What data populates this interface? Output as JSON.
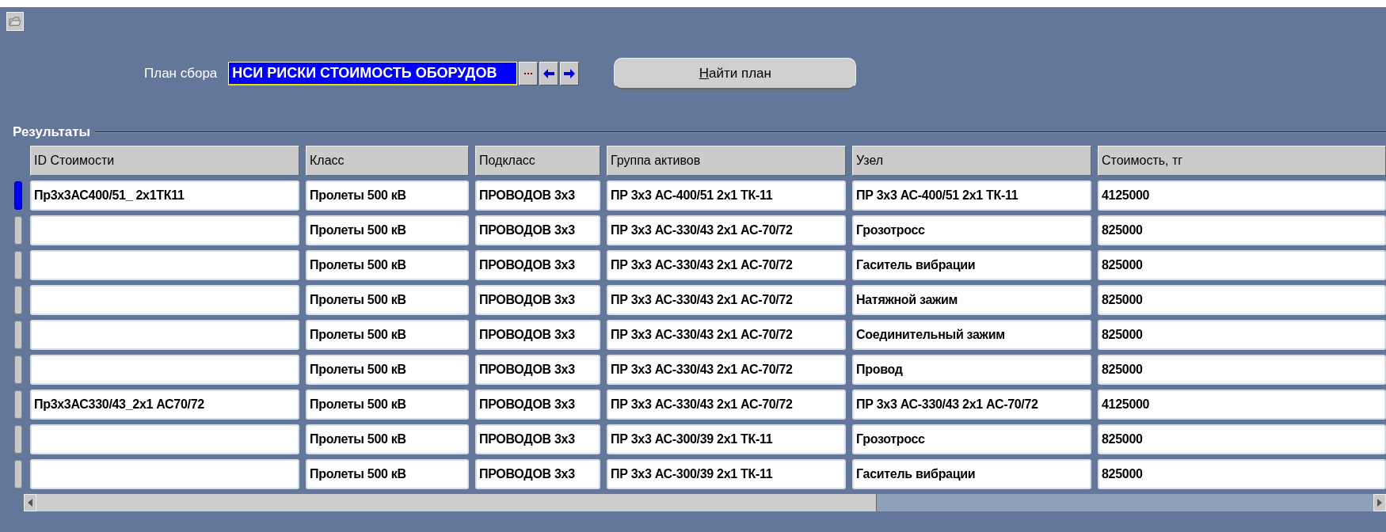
{
  "plan": {
    "label": "План сбора",
    "value": "НСИ РИСКИ СТОИМОСТЬ ОБОРУДОВ",
    "selected": true
  },
  "find_button": {
    "access_key": "Н",
    "label_rest": "айти план"
  },
  "results": {
    "title": "Результаты",
    "columns": [
      "ID Стоимости",
      "Класс",
      "Подкласс",
      "Группа активов",
      "Узел",
      "Стоимость, тг"
    ],
    "rows": [
      {
        "current": true,
        "cells": [
          "Пр3х3АС400/51_ 2х1ТК11",
          "Пролеты 500 кВ",
          "ПРОВОДОВ 3х3",
          "ПР 3х3 АС-400/51 2х1 ТК-11",
          "ПР 3х3 АС-400/51 2х1 ТК-11",
          "4125000"
        ]
      },
      {
        "current": false,
        "cells": [
          "",
          "Пролеты 500 кВ",
          "ПРОВОДОВ 3х3",
          "ПР 3х3 АС-330/43 2х1 АС-70/72",
          "Грозотросс",
          "825000"
        ]
      },
      {
        "current": false,
        "cells": [
          "",
          "Пролеты 500 кВ",
          "ПРОВОДОВ 3х3",
          "ПР 3х3 АС-330/43 2х1 АС-70/72",
          "Гаситель вибрации",
          "825000"
        ]
      },
      {
        "current": false,
        "cells": [
          "",
          "Пролеты 500 кВ",
          "ПРОВОДОВ 3х3",
          "ПР 3х3 АС-330/43 2х1 АС-70/72",
          "Натяжной зажим",
          "825000"
        ]
      },
      {
        "current": false,
        "cells": [
          "",
          "Пролеты 500 кВ",
          "ПРОВОДОВ 3х3",
          "ПР 3х3 АС-330/43 2х1 АС-70/72",
          "Соединительный зажим",
          "825000"
        ]
      },
      {
        "current": false,
        "cells": [
          "",
          "Пролеты 500 кВ",
          "ПРОВОДОВ 3х3",
          "ПР 3х3 АС-330/43 2х1 АС-70/72",
          "Провод",
          "825000"
        ]
      },
      {
        "current": false,
        "cells": [
          "Пр3х3АС330/43_2х1 АС70/72",
          "Пролеты 500 кВ",
          "ПРОВОДОВ 3х3",
          "ПР 3х3 АС-330/43 2х1 АС-70/72",
          "ПР 3х3 АС-330/43 2х1 АС-70/72",
          "4125000"
        ]
      },
      {
        "current": false,
        "cells": [
          "",
          "Пролеты 500 кВ",
          "ПРОВОДОВ 3х3",
          "ПР 3х3 АС-300/39 2х1 ТК-11",
          "Грозотросс",
          "825000"
        ]
      },
      {
        "current": false,
        "cells": [
          "",
          "Пролеты 500 кВ",
          "ПРОВОДОВ 3х3",
          "ПР 3х3 АС-300/39 2х1 ТК-11",
          "Гаситель вибрации",
          "825000"
        ]
      }
    ]
  }
}
